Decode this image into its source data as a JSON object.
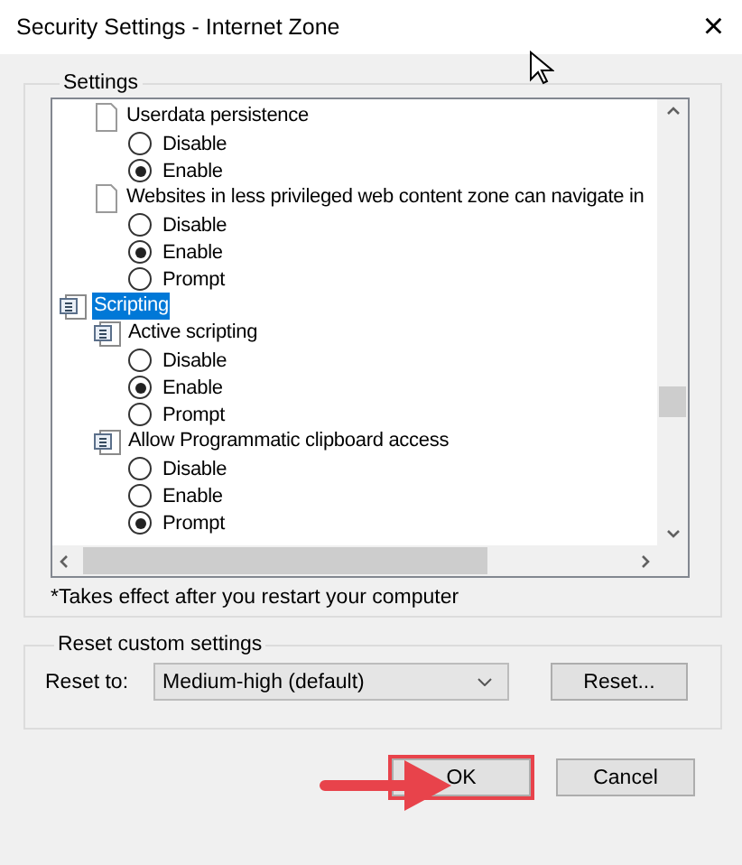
{
  "window": {
    "title": "Security Settings - Internet Zone",
    "close": "×"
  },
  "settings": {
    "legend": "Settings",
    "items": [
      {
        "kind": "page",
        "label": "Userdata persistence",
        "selected": false,
        "options": [
          {
            "label": "Disable",
            "selected": false
          },
          {
            "label": "Enable",
            "selected": true
          }
        ]
      },
      {
        "kind": "page",
        "label": "Websites in less privileged web content zone can navigate in",
        "selected": false,
        "options": [
          {
            "label": "Disable",
            "selected": false
          },
          {
            "label": "Enable",
            "selected": true
          },
          {
            "label": "Prompt",
            "selected": false
          }
        ]
      },
      {
        "kind": "category",
        "label": "Scripting",
        "selected": true,
        "children": [
          {
            "kind": "script",
            "label": "Active scripting",
            "selected": false,
            "options": [
              {
                "label": "Disable",
                "selected": false
              },
              {
                "label": "Enable",
                "selected": true
              },
              {
                "label": "Prompt",
                "selected": false
              }
            ]
          },
          {
            "kind": "script",
            "label": "Allow Programmatic clipboard access",
            "selected": false,
            "options": [
              {
                "label": "Disable",
                "selected": false
              },
              {
                "label": "Enable",
                "selected": false
              },
              {
                "label": "Prompt",
                "selected": true
              }
            ]
          }
        ]
      }
    ],
    "note": "*Takes effect after you restart your computer"
  },
  "reset": {
    "legend": "Reset custom settings",
    "label": "Reset to:",
    "value": "Medium-high (default)",
    "button": "Reset..."
  },
  "buttons": [
    {
      "label": "OK",
      "highlighted": true
    },
    {
      "label": "Cancel",
      "highlighted": false
    }
  ]
}
